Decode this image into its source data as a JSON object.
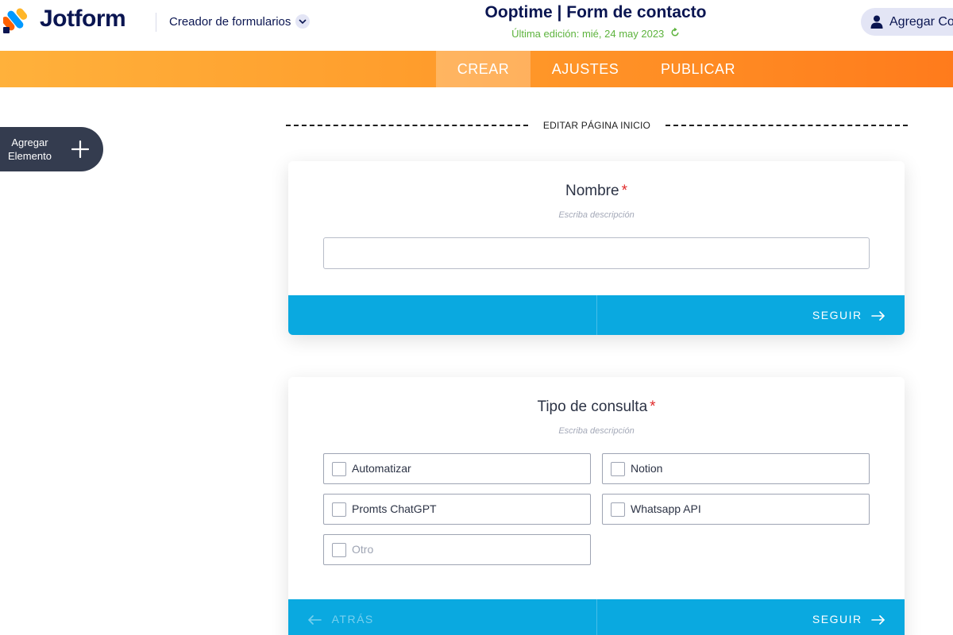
{
  "header": {
    "logo_text": "Jotform",
    "builder_label": "Creador de formularios",
    "form_title": "Ooptime | Form de contacto",
    "last_edit": "Última edición: mié, 24 may 2023",
    "add_collaborator": "Agregar Co"
  },
  "nav": {
    "tabs": [
      {
        "label": "CREAR",
        "active": true
      },
      {
        "label": "AJUSTES",
        "active": false
      },
      {
        "label": "PUBLICAR",
        "active": false
      }
    ]
  },
  "sidebar": {
    "add_element_line1": "Agregar",
    "add_element_line2": "Elemento"
  },
  "page_separator": {
    "label": "EDITAR PÁGINA INICIO"
  },
  "questions": [
    {
      "title": "Nombre",
      "required_mark": "*",
      "description": "Escriba descripción",
      "input_value": "",
      "next_label": "SEGUIR"
    },
    {
      "title": "Tipo de consulta",
      "required_mark": "*",
      "description": "Escriba descripción",
      "options": [
        {
          "label": "Automatizar",
          "checked": false
        },
        {
          "label": "Notion",
          "checked": false
        },
        {
          "label": "Promts ChatGPT",
          "checked": false
        },
        {
          "label": "Whatsapp API",
          "checked": false
        },
        {
          "label": "Otro",
          "checked": false
        }
      ],
      "back_label": "ATRÁS",
      "next_label": "SEGUIR"
    }
  ],
  "colors": {
    "brand_navy": "#0a1551",
    "nav_gradient_start": "#ffb13b",
    "nav_gradient_end": "#ff7b1c",
    "footer_blue": "#0aa9e0",
    "required_red": "#e02b2b",
    "edit_green": "#5db33d"
  }
}
